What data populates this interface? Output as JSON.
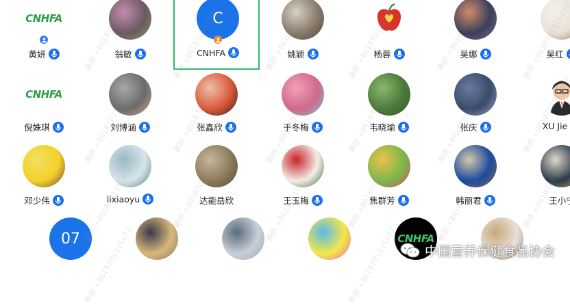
{
  "participants": [
    {
      "name": "黄妍",
      "avatar": {
        "kind": "logo",
        "text": "CNHFA"
      },
      "badge": "blue",
      "mic": true
    },
    {
      "name": "翁敏",
      "avatar": {
        "kind": "photo",
        "colors": [
          "#6b5a62",
          "#c48bb0",
          "#7a9a5a"
        ]
      },
      "mic": true
    },
    {
      "name": "CNHFA",
      "avatar": {
        "kind": "letter",
        "letter": "C",
        "color": "#1a73e8"
      },
      "badge": "orange",
      "mic": true,
      "active": true
    },
    {
      "name": "姚颖",
      "avatar": {
        "kind": "photo",
        "colors": [
          "#8a7a6a",
          "#d9d2c8",
          "#4a4a3a"
        ]
      },
      "mic": true
    },
    {
      "name": "杨蓉",
      "avatar": {
        "kind": "apple"
      },
      "mic": true
    },
    {
      "name": "吴娜",
      "avatar": {
        "kind": "photo",
        "colors": [
          "#3a3f5a",
          "#d48a6a",
          "#7a6a8a"
        ]
      },
      "mic": true
    },
    {
      "name": "吴红",
      "avatar": {
        "kind": "photo",
        "colors": [
          "#e8e2d8",
          "#f4f0ea",
          "#9a7a5a"
        ]
      },
      "mic": true
    },
    {
      "name": "倪姝琪",
      "avatar": {
        "kind": "logo",
        "text": "CNHFA"
      },
      "mic": true
    },
    {
      "name": "刘博涵",
      "avatar": {
        "kind": "photo",
        "colors": [
          "#6a6a6a",
          "#a8a8a8",
          "#d8a890"
        ]
      },
      "mic": true
    },
    {
      "name": "张鑫欣",
      "avatar": {
        "kind": "photo",
        "colors": [
          "#d8583a",
          "#f0c0a8",
          "#2a2020"
        ]
      },
      "mic": true
    },
    {
      "name": "于冬梅",
      "avatar": {
        "kind": "photo",
        "colors": [
          "#d06a8a",
          "#f2a0b8",
          "#7ac0d8"
        ]
      },
      "mic": true
    },
    {
      "name": "韦晓瑜",
      "avatar": {
        "kind": "photo",
        "colors": [
          "#4a7a3a",
          "#8ab86a",
          "#3a5a2a"
        ]
      },
      "mic": true
    },
    {
      "name": "张庆",
      "avatar": {
        "kind": "photo",
        "colors": [
          "#3a4a6a",
          "#6a7aa0",
          "#9aa8c8"
        ]
      },
      "mic": true
    },
    {
      "name": "XU Jie",
      "avatar": {
        "kind": "cartoon",
        "colors": [
          "#ffffff",
          "#f2c8a0",
          "#2a2a2a"
        ]
      },
      "mic": true
    },
    {
      "name": "邓少伟",
      "avatar": {
        "kind": "photo",
        "colors": [
          "#f4d02a",
          "#f0e060",
          "#6a4a2a"
        ]
      },
      "mic": true
    },
    {
      "name": "lixiaoyu",
      "avatar": {
        "kind": "photo",
        "colors": [
          "#d8e4ea",
          "#9ab8c4",
          "#5a7a8a"
        ]
      },
      "mic": true
    },
    {
      "name": "达能岳欣",
      "avatar": {
        "kind": "photo",
        "colors": [
          "#8a7a5a",
          "#c8b89a",
          "#5a4a3a"
        ]
      },
      "mic": false
    },
    {
      "name": "王玉梅",
      "avatar": {
        "kind": "photo",
        "colors": [
          "#f4eee8",
          "#c8242a",
          "#3a6a2a"
        ]
      },
      "mic": true
    },
    {
      "name": "焦群芳",
      "avatar": {
        "kind": "photo",
        "colors": [
          "#7ab84a",
          "#f0c04a",
          "#d84a6a"
        ]
      },
      "mic": true
    },
    {
      "name": "韩丽君",
      "avatar": {
        "kind": "photo",
        "colors": [
          "#1a4aa0",
          "#d8c8a8",
          "#8a6a4a"
        ]
      },
      "mic": true
    },
    {
      "name": "王小宁",
      "avatar": {
        "kind": "photo",
        "colors": [
          "#2a3a4a",
          "#e0d8c8",
          "#c8a870"
        ]
      },
      "mic": false
    },
    {
      "name": "",
      "avatar": {
        "kind": "letter",
        "letter": "07",
        "color": "#1a73e8"
      },
      "mic": false
    },
    {
      "name": "",
      "avatar": {
        "kind": "photo",
        "colors": [
          "#d8b87a",
          "#3a3a4a",
          "#8a7a6a"
        ]
      },
      "mic": false
    },
    {
      "name": "",
      "avatar": {
        "kind": "photo",
        "colors": [
          "#c8d0d8",
          "#5a6a7a",
          "#9aa8b4"
        ]
      },
      "mic": false
    },
    {
      "name": "",
      "avatar": {
        "kind": "photo",
        "colors": [
          "#f4e84a",
          "#5ab8e8",
          "#e86aa8"
        ]
      },
      "mic": false
    },
    {
      "name": "",
      "avatar": {
        "kind": "logo-dark",
        "text": "CNHFA"
      },
      "mic": false
    },
    {
      "name": "",
      "avatar": {
        "kind": "photo",
        "colors": [
          "#e8e0d8",
          "#c8a878",
          "#9a8a7a"
        ]
      },
      "mic": false
    }
  ],
  "footer": {
    "org_name": "中国营养保健食品协会"
  },
  "watermark": {
    "text": "黄妍 +8618701315477"
  },
  "colors": {
    "mic": "#1a6ff0",
    "active_border": "#2fb86a",
    "host_badge": "#f08a2a"
  }
}
